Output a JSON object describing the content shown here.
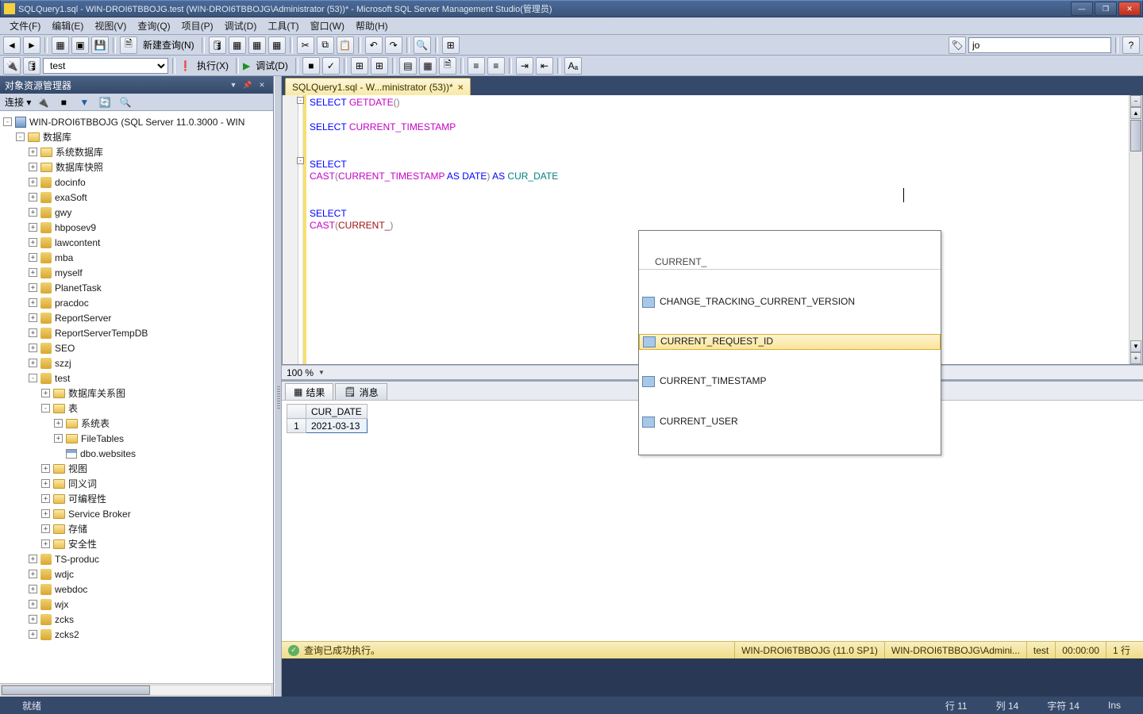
{
  "window": {
    "title": "SQLQuery1.sql - WIN-DROI6TBBOJG.test (WIN-DROI6TBBOJG\\Administrator (53))* - Microsoft SQL Server Management Studio(管理员)"
  },
  "menu": [
    "文件(F)",
    "编辑(E)",
    "视图(V)",
    "查询(Q)",
    "项目(P)",
    "调试(D)",
    "工具(T)",
    "窗口(W)",
    "帮助(H)"
  ],
  "toolbar": {
    "new_query": "新建查询(N)",
    "execute": "执行(X)",
    "debug": "调试(D)",
    "db_selector": "test",
    "search_box": "jo"
  },
  "object_explorer": {
    "title": "对象资源管理器",
    "connect_label": "连接 ▾",
    "server": "WIN-DROI6TBBOJG (SQL Server 11.0.3000 - WIN",
    "root_folder": "数据库",
    "sys_folders": [
      "系统数据库",
      "数据库快照"
    ],
    "databases": [
      "docinfo",
      "exaSoft",
      "gwy",
      "hbposev9",
      "lawcontent",
      "mba",
      "myself",
      "PlanetTask",
      "pracdoc",
      "ReportServer",
      "ReportServerTempDB",
      "SEO",
      "szzj",
      "test",
      "TS-produc",
      "wdjc",
      "webdoc",
      "wjx",
      "zcks",
      "zcks2"
    ],
    "test_children": {
      "diagram": "数据库关系图",
      "tables": "表",
      "tables_children": [
        "系统表",
        "FileTables",
        "dbo.websites"
      ],
      "others": [
        "视图",
        "同义词",
        "可编程性",
        "Service Broker",
        "存储",
        "安全性"
      ]
    }
  },
  "editor": {
    "tab_label": "SQLQuery1.sql - W...ministrator (53))*",
    "zoom": "100 %",
    "code": {
      "l1a": "SELECT ",
      "l1b": "GETDATE",
      "l1c": "()",
      "l3a": "SELECT ",
      "l3b": "CURRENT_TIMESTAMP",
      "l5a": "SELECT",
      "l6a": "CAST",
      "l6b": "(",
      "l6c": "CURRENT_TIMESTAMP ",
      "l6d": "AS ",
      "l6e": "DATE",
      "l6f": ") ",
      "l6g": "AS ",
      "l6h": "CUR_DATE",
      "l8a": "SELECT",
      "l9a": "CAST",
      "l9b": "(",
      "l9c": "CURRENT_",
      "l9d": ")"
    }
  },
  "intellisense": {
    "filter": "CURRENT_",
    "items": [
      "CHANGE_TRACKING_CURRENT_VERSION",
      "CURRENT_REQUEST_ID",
      "CURRENT_TIMESTAMP",
      "CURRENT_USER"
    ],
    "selected_index": 1
  },
  "results": {
    "tab_results": "结果",
    "tab_messages": "消息",
    "columns": [
      "CUR_DATE"
    ],
    "rows": [
      [
        "2021-03-13"
      ]
    ],
    "rownum": "1"
  },
  "status_query": {
    "message": "查询已成功执行。",
    "server": "WIN-DROI6TBBOJG (11.0 SP1)",
    "login": "WIN-DROI6TBBOJG\\Admini...",
    "db": "test",
    "elapsed": "00:00:00",
    "rows": "1 行"
  },
  "status_app": {
    "ready": "就绪",
    "line": "行 11",
    "col": "列 14",
    "char": "字符 14",
    "ins": "Ins"
  }
}
